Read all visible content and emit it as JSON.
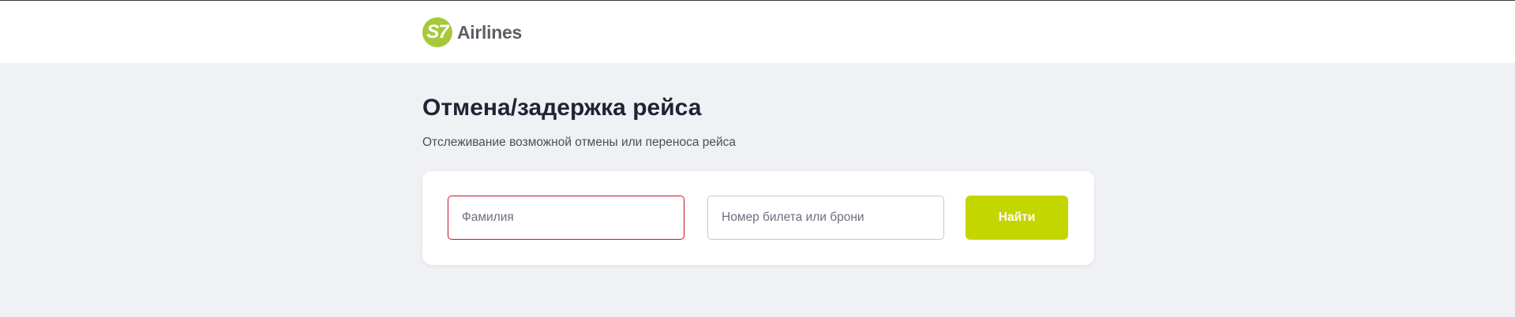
{
  "header": {
    "logo": {
      "mark": "S7",
      "text": "Airlines"
    }
  },
  "main": {
    "title": "Отмена/задержка рейса",
    "subtitle": "Отслеживание возможной отмены или переноса рейса",
    "form": {
      "lastname": {
        "value": "",
        "placeholder": "Фамилия"
      },
      "ticket": {
        "value": "",
        "placeholder": "Номер билета или брони"
      },
      "search_label": "Найти"
    }
  },
  "colors": {
    "brand_green": "#c4d600",
    "logo_green": "#a8c83b",
    "error_border": "#c8102e",
    "page_background": "#f0f1f5"
  }
}
